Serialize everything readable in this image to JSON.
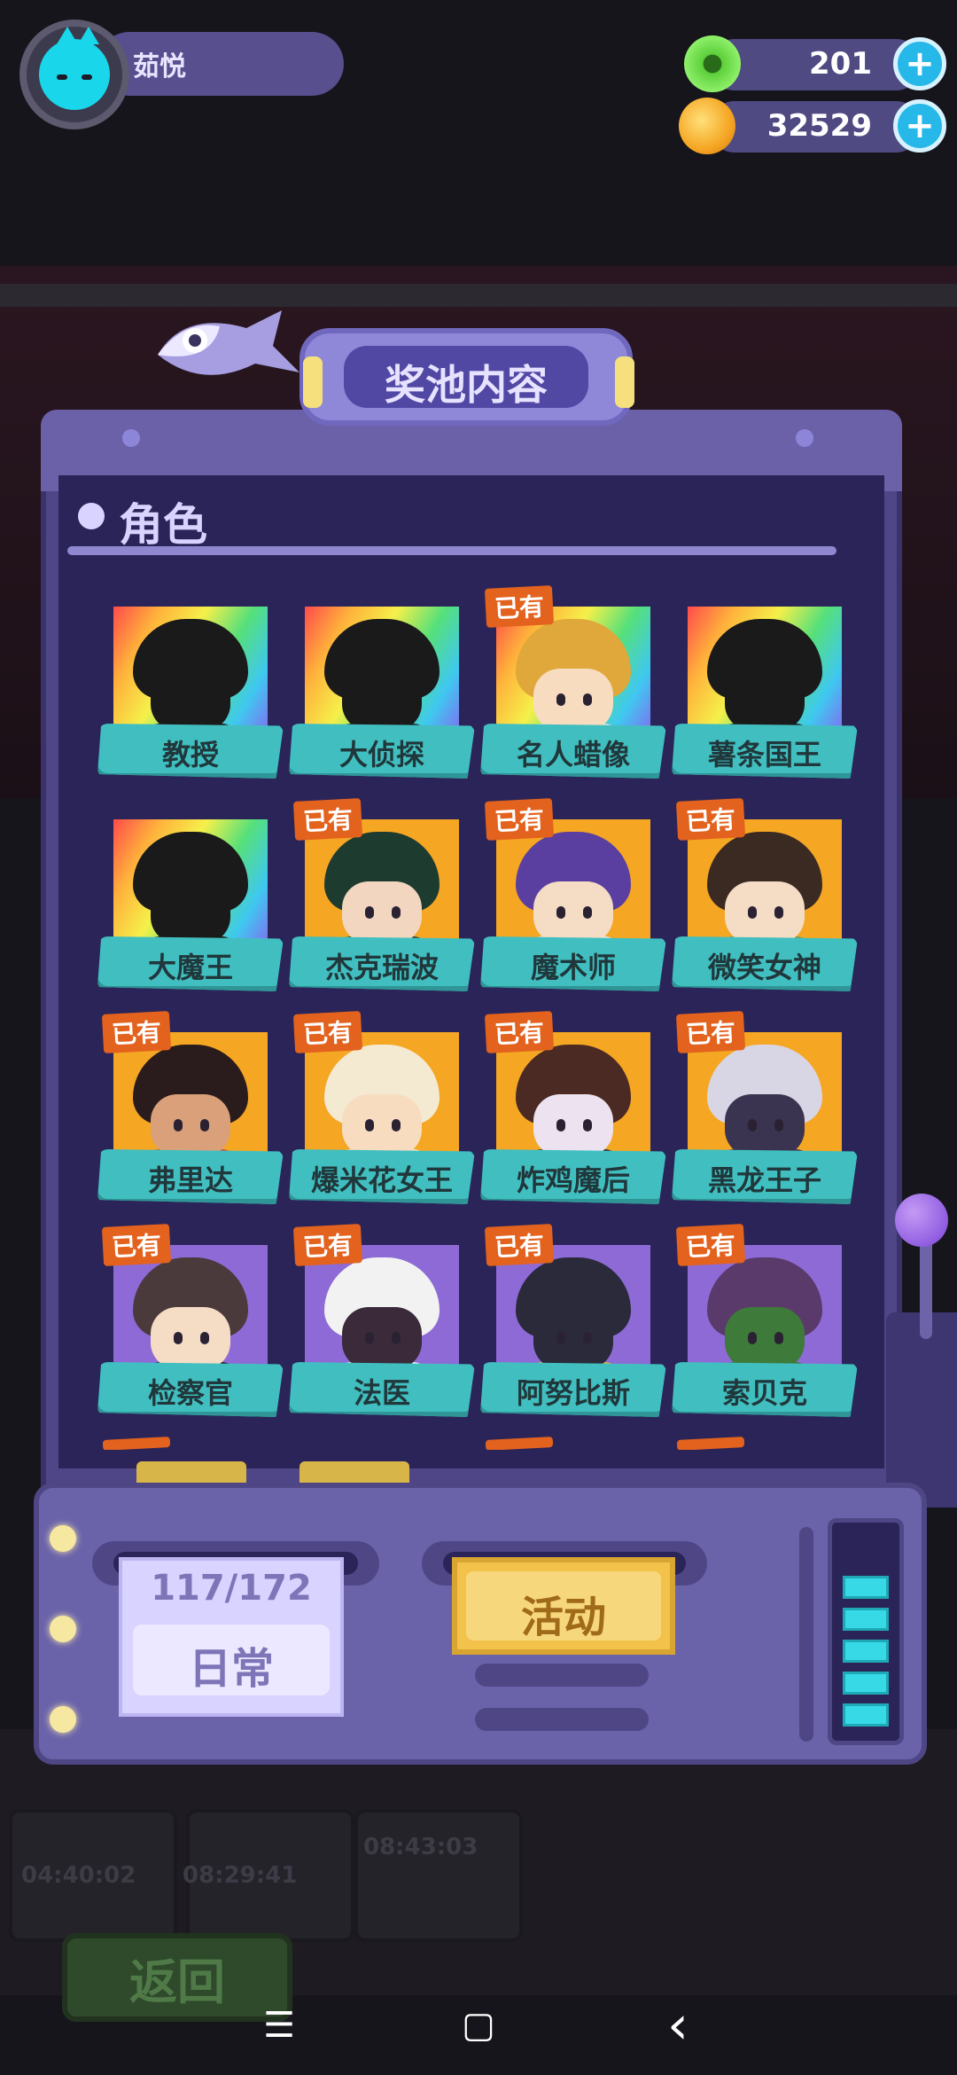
{
  "hud": {
    "player_name": "茹悦",
    "currencies": [
      {
        "icon": "green-gem-icon",
        "value": "201",
        "color": "#5ccf3a"
      },
      {
        "icon": "gold-planet-icon",
        "value": "32529",
        "color": "#f5a623"
      }
    ]
  },
  "panel": {
    "title": "奖池内容",
    "section_title": "角色",
    "owned_badge": "已有"
  },
  "characters": [
    {
      "name": "教授",
      "frame": "rainbow",
      "owned": false,
      "hair": "#1a1a1a",
      "face": "#1a1a1a",
      "body": "#1a1a1a"
    },
    {
      "name": "大侦探",
      "frame": "rainbow",
      "owned": false,
      "hair": "#1a1a1a",
      "face": "#1a1a1a",
      "body": "#1a1a1a"
    },
    {
      "name": "名人蜡像",
      "frame": "rainbow",
      "owned": true,
      "hair": "#e0a83a",
      "face": "#f7dcc0",
      "body": "#e8e2d6"
    },
    {
      "name": "薯条国王",
      "frame": "rainbow",
      "owned": false,
      "hair": "#1a1a1a",
      "face": "#1a1a1a",
      "body": "#1a1a1a"
    },
    {
      "name": "大魔王",
      "frame": "rainbow",
      "owned": false,
      "hair": "#1a1a1a",
      "face": "#1a1a1a",
      "body": "#1a1a1a"
    },
    {
      "name": "杰克瑞波",
      "frame": "gold",
      "owned": true,
      "hair": "#1e3b30",
      "face": "#f2d6bf",
      "body": "#1e3b30"
    },
    {
      "name": "魔术师",
      "frame": "gold",
      "owned": true,
      "hair": "#5b3fa0",
      "face": "#f4dcc5",
      "body": "#ece8f4"
    },
    {
      "name": "微笑女神",
      "frame": "gold",
      "owned": true,
      "hair": "#3b2a22",
      "face": "#f4dcc5",
      "body": "#6a9a4a"
    },
    {
      "name": "弗里达",
      "frame": "gold",
      "owned": true,
      "hair": "#2a1c1c",
      "face": "#d9a07a",
      "body": "#c0524a"
    },
    {
      "name": "爆米花女王",
      "frame": "gold",
      "owned": true,
      "hair": "#f4ead2",
      "face": "#f7dcc0",
      "body": "#f4ead2"
    },
    {
      "name": "炸鸡魔后",
      "frame": "gold",
      "owned": true,
      "hair": "#4a2a22",
      "face": "#ece2f0",
      "body": "#2a2233"
    },
    {
      "name": "黑龙王子",
      "frame": "gold",
      "owned": true,
      "hair": "#d8d6e4",
      "face": "#3a3450",
      "body": "#3a3450"
    },
    {
      "name": "检察官",
      "frame": "purple",
      "owned": true,
      "hair": "#4a3a3c",
      "face": "#f4dcc5",
      "body": "#2a2233"
    },
    {
      "name": "法医",
      "frame": "purple",
      "owned": true,
      "hair": "#f2f2f2",
      "face": "#3a2a3a",
      "body": "#f2f2f2"
    },
    {
      "name": "阿努比斯",
      "frame": "purple",
      "owned": true,
      "hair": "#2a2a3a",
      "face": "#2a2a3a",
      "body": "#e8b63a"
    },
    {
      "name": "索贝克",
      "frame": "purple",
      "owned": true,
      "hair": "#5a3a6a",
      "face": "#3e7a3a",
      "body": "#3e7a3a"
    }
  ],
  "machine": {
    "progress": "117/172",
    "daily_tab": "日常",
    "event_tab": "活动",
    "meter_levels": 5
  },
  "background": {
    "back_button": "返回",
    "timers": [
      "04:40:02",
      "08:29:41",
      "08:43:03"
    ]
  },
  "nav": {
    "menu_icon": "☰",
    "home_icon": "▢",
    "back_icon": "‹"
  }
}
